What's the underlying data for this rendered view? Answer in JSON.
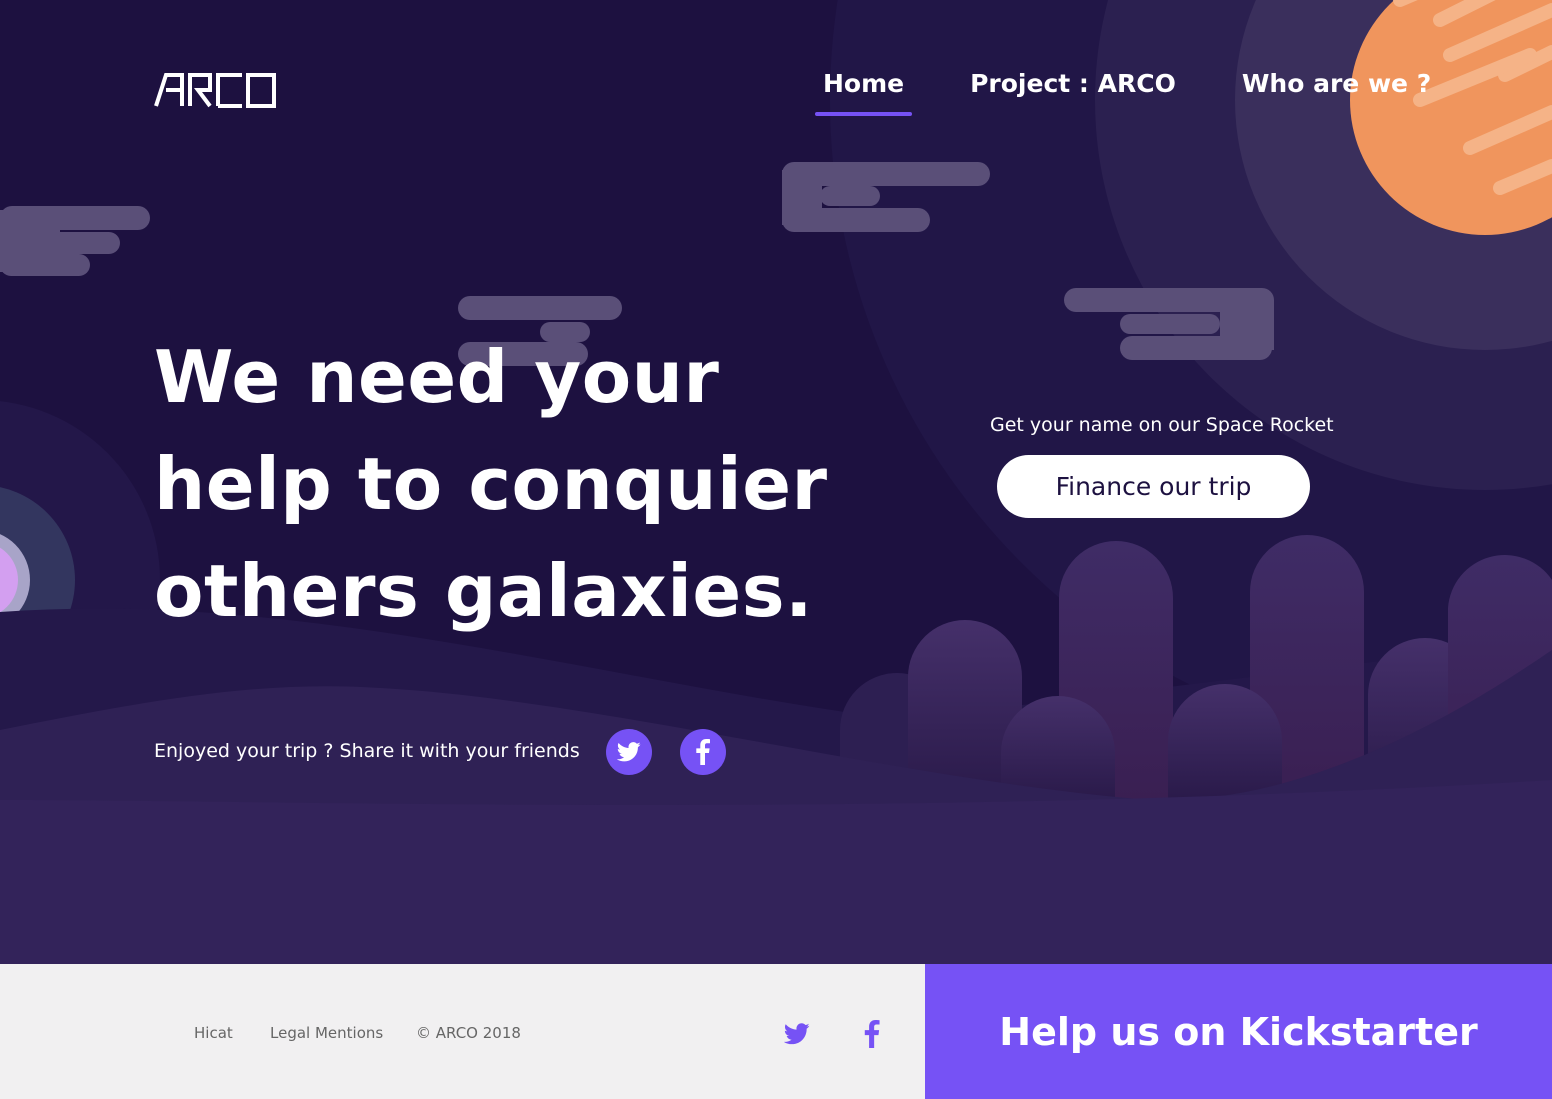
{
  "brand": {
    "logo_text": "ARCO"
  },
  "nav": {
    "items": [
      {
        "label": "Home",
        "active": true
      },
      {
        "label": "Project : ARCO",
        "active": false
      },
      {
        "label": "Who are we ?",
        "active": false
      }
    ]
  },
  "hero": {
    "headline": [
      "We need your",
      "help to conquier",
      "others galaxies."
    ],
    "cta_caption": "Get your name on our Space Rocket",
    "cta_button": "Finance our trip",
    "share_text": "Enjoyed your trip ? Share it with your friends",
    "share_icons": [
      "twitter-icon",
      "facebook-icon"
    ]
  },
  "footer": {
    "links": [
      "Hicat",
      "Legal Mentions",
      "© ARCO 2018"
    ],
    "social_icons": [
      "twitter-icon",
      "facebook-icon"
    ],
    "kickstarter_label": "Help us on Kickstarter"
  },
  "colors": {
    "background": "#1d1140",
    "accent": "#7652f5",
    "planet": "#f0955d",
    "footer_bg": "#f1f0f1",
    "cta_bg": "#ffffff"
  }
}
